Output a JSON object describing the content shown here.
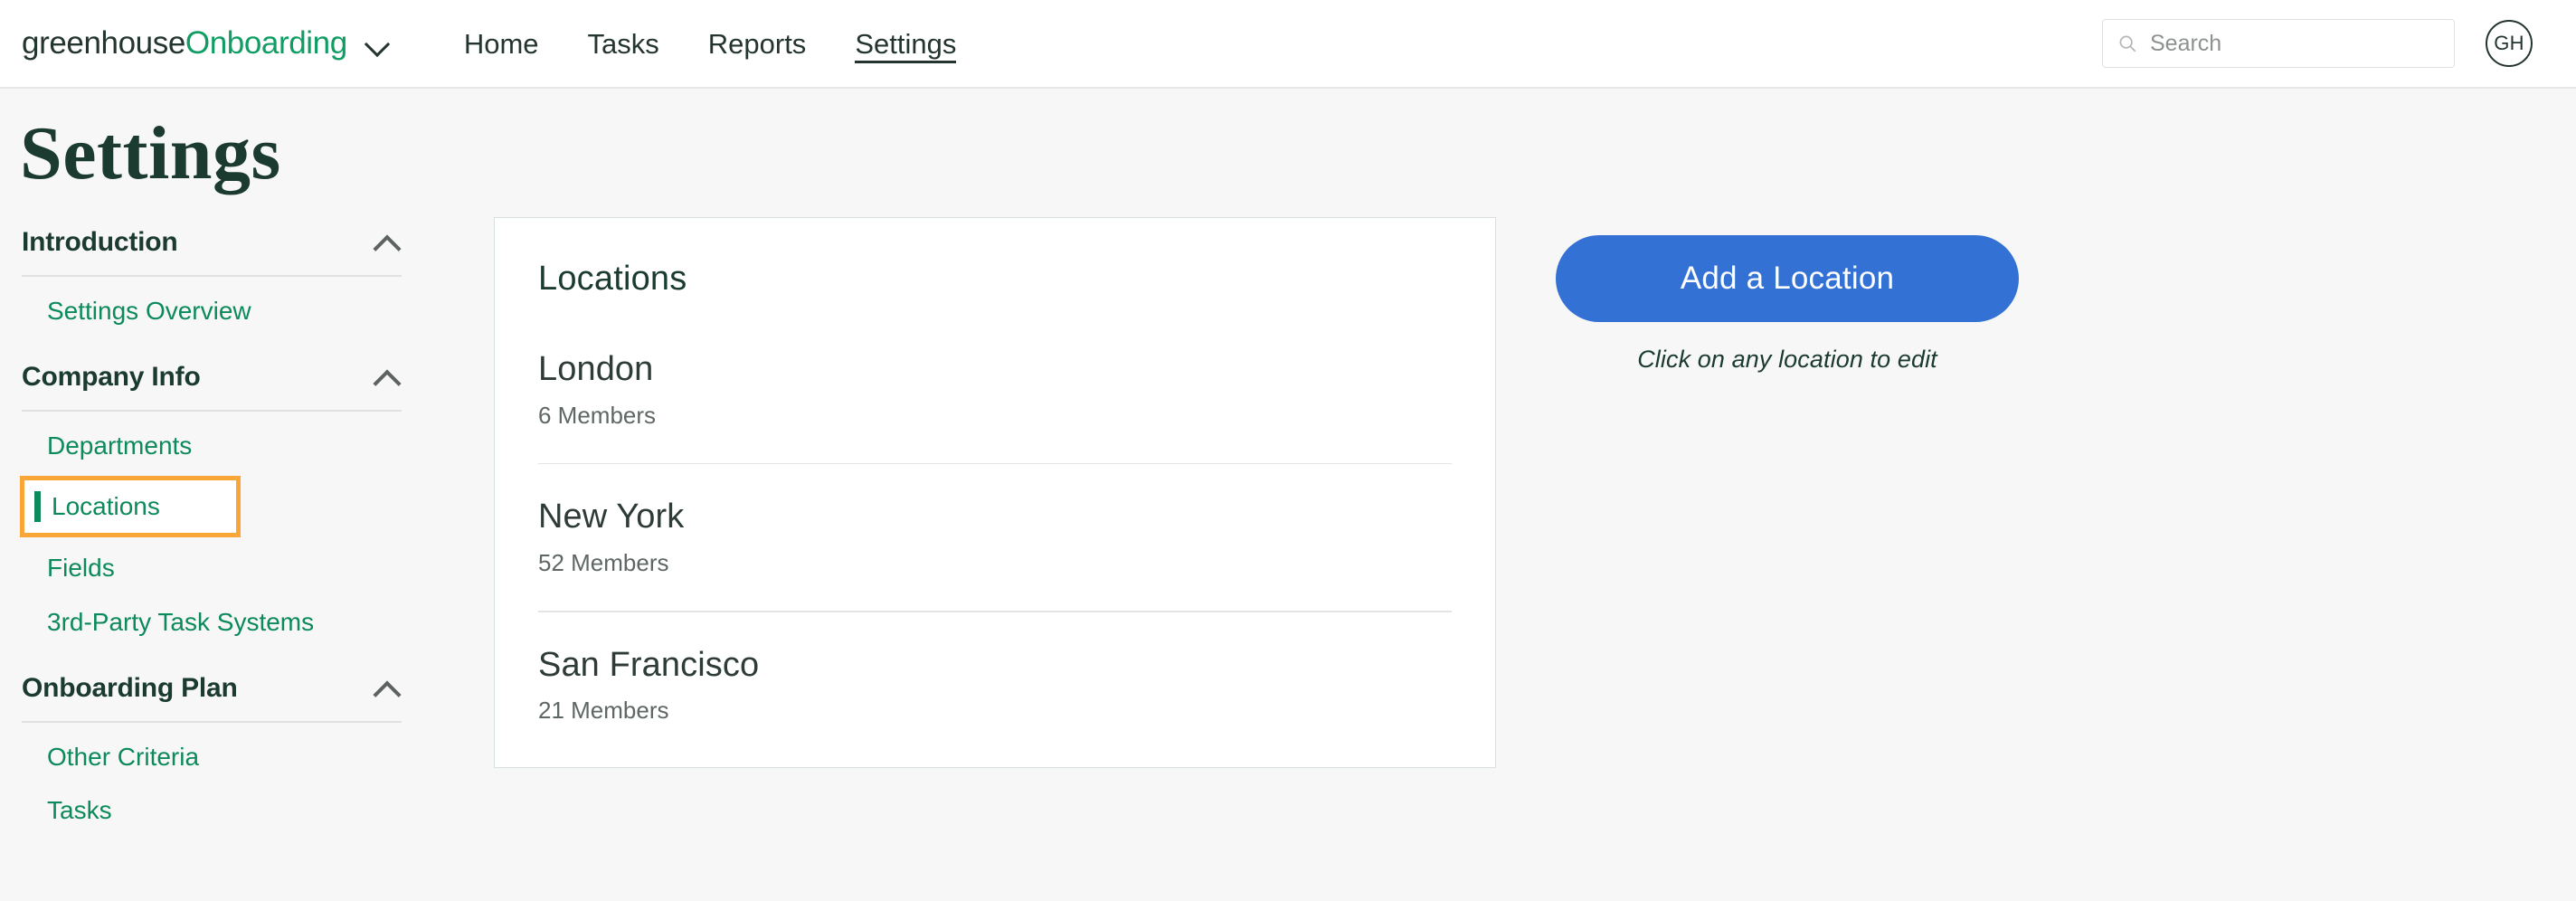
{
  "header": {
    "brand_primary": "greenhouse",
    "brand_secondary": "Onboarding",
    "nav": [
      {
        "label": "Home",
        "active": false
      },
      {
        "label": "Tasks",
        "active": false
      },
      {
        "label": "Reports",
        "active": false
      },
      {
        "label": "Settings",
        "active": true
      }
    ],
    "search_placeholder": "Search",
    "search_value": "",
    "avatar_initials": "GH"
  },
  "page": {
    "title": "Settings"
  },
  "sidebar": {
    "sections": [
      {
        "title": "Introduction",
        "links": [
          {
            "label": "Settings Overview",
            "current": false
          }
        ]
      },
      {
        "title": "Company Info",
        "links": [
          {
            "label": "Departments",
            "current": false
          },
          {
            "label": "Locations",
            "current": true
          },
          {
            "label": "Fields",
            "current": false
          },
          {
            "label": "3rd-Party Task Systems",
            "current": false
          }
        ]
      },
      {
        "title": "Onboarding Plan",
        "links": [
          {
            "label": "Other Criteria",
            "current": false
          },
          {
            "label": "Tasks",
            "current": false
          }
        ]
      }
    ]
  },
  "card": {
    "title": "Locations",
    "locations": [
      {
        "name": "London",
        "members": "6 Members"
      },
      {
        "name": "New York",
        "members": "52 Members"
      },
      {
        "name": "San Francisco",
        "members": "21 Members"
      }
    ]
  },
  "actions": {
    "add_label": "Add a Location",
    "hint": "Click on any location to edit"
  },
  "colors": {
    "brand_green": "#0f9d63",
    "link_green": "#0d8a5b",
    "dark_green": "#1b3b30",
    "primary_blue": "#3372d4",
    "highlight_orange": "#f9a537",
    "page_bg": "#f7f7f7"
  }
}
